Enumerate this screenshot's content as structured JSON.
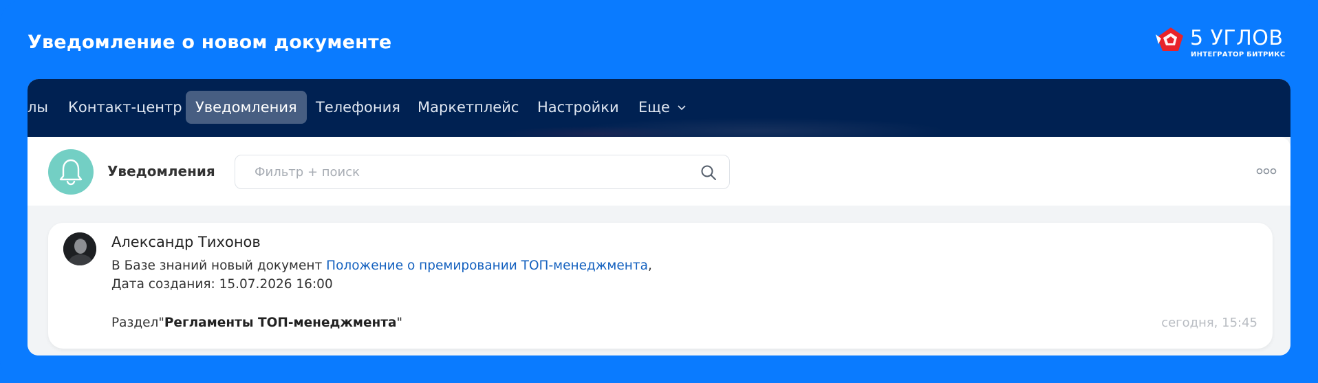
{
  "header": {
    "title": "Уведомление о новом документе",
    "brand_name": "5 УГЛОВ",
    "brand_sub": "ИНТЕГРАТОР БИТРИКС",
    "logo_icon": "red-pentagon-star-icon",
    "accent_color": "#0a7bff",
    "nav_bg": "#002152"
  },
  "nav": {
    "items": [
      {
        "label": "лы"
      },
      {
        "label": "Контакт-центр"
      },
      {
        "label": "Уведомления",
        "active": true
      },
      {
        "label": "Телефония"
      },
      {
        "label": "Маркетплейс"
      },
      {
        "label": "Настройки"
      },
      {
        "label": "Еще"
      }
    ]
  },
  "panel": {
    "title": "Уведомления",
    "bell_icon": "bell-icon",
    "search_placeholder": "Фильтр + поиск",
    "search_value": "",
    "more_icon": "more-dots-icon"
  },
  "notification": {
    "author": "Александр Тихонов",
    "line1_prefix": "В Базе знаний новый документ ",
    "doc_link": "Положение о премировании ТОП-менеджмента",
    "line1_suffix": ",",
    "line2": "Дата создания: 15.07.2026 16:00",
    "section_prefix": "Раздел\"",
    "section_name": "Регламенты ТОП-менеджмента",
    "section_suffix": "\"",
    "time": "сегодня, 15:45"
  }
}
